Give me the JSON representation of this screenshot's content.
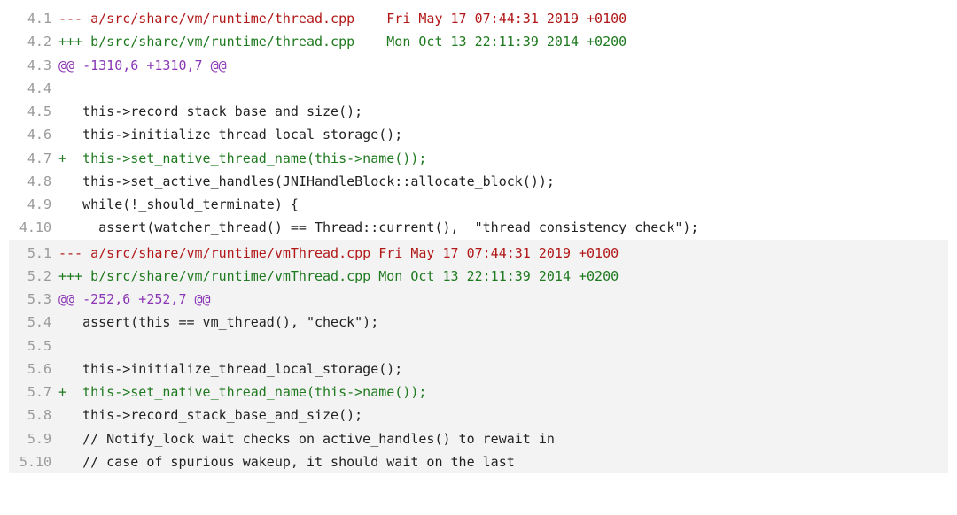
{
  "files": [
    {
      "alt": false,
      "lines": [
        {
          "ln": "4.1",
          "cls": "minus",
          "text": "--- a/src/share/vm/runtime/thread.cpp    Fri May 17 07:44:31 2019 +0100"
        },
        {
          "ln": "4.2",
          "cls": "plus",
          "text": "+++ b/src/share/vm/runtime/thread.cpp    Mon Oct 13 22:11:39 2014 +0200"
        },
        {
          "ln": "4.3",
          "cls": "hunk",
          "text": "@@ -1310,6 +1310,7 @@"
        },
        {
          "ln": "4.4",
          "cls": "norm",
          "text": " "
        },
        {
          "ln": "4.5",
          "cls": "norm",
          "text": "   this->record_stack_base_and_size();"
        },
        {
          "ln": "4.6",
          "cls": "norm",
          "text": "   this->initialize_thread_local_storage();"
        },
        {
          "ln": "4.7",
          "cls": "plus",
          "text": "+  this->set_native_thread_name(this->name());"
        },
        {
          "ln": "4.8",
          "cls": "norm",
          "text": "   this->set_active_handles(JNIHandleBlock::allocate_block());"
        },
        {
          "ln": "4.9",
          "cls": "norm",
          "text": "   while(!_should_terminate) {"
        },
        {
          "ln": "4.10",
          "cls": "norm",
          "text": "     assert(watcher_thread() == Thread::current(),  \"thread consistency check\");"
        }
      ]
    },
    {
      "alt": true,
      "lines": [
        {
          "ln": "5.1",
          "cls": "minus",
          "text": "--- a/src/share/vm/runtime/vmThread.cpp Fri May 17 07:44:31 2019 +0100"
        },
        {
          "ln": "5.2",
          "cls": "plus",
          "text": "+++ b/src/share/vm/runtime/vmThread.cpp Mon Oct 13 22:11:39 2014 +0200"
        },
        {
          "ln": "5.3",
          "cls": "hunk",
          "text": "@@ -252,6 +252,7 @@"
        },
        {
          "ln": "5.4",
          "cls": "norm",
          "text": "   assert(this == vm_thread(), \"check\");"
        },
        {
          "ln": "5.5",
          "cls": "norm",
          "text": " "
        },
        {
          "ln": "5.6",
          "cls": "norm",
          "text": "   this->initialize_thread_local_storage();"
        },
        {
          "ln": "5.7",
          "cls": "plus",
          "text": "+  this->set_native_thread_name(this->name());"
        },
        {
          "ln": "5.8",
          "cls": "norm",
          "text": "   this->record_stack_base_and_size();"
        },
        {
          "ln": "5.9",
          "cls": "norm",
          "text": "   // Notify_lock wait checks on active_handles() to rewait in"
        },
        {
          "ln": "5.10",
          "cls": "norm",
          "text": "   // case of spurious wakeup, it should wait on the last"
        }
      ]
    }
  ]
}
